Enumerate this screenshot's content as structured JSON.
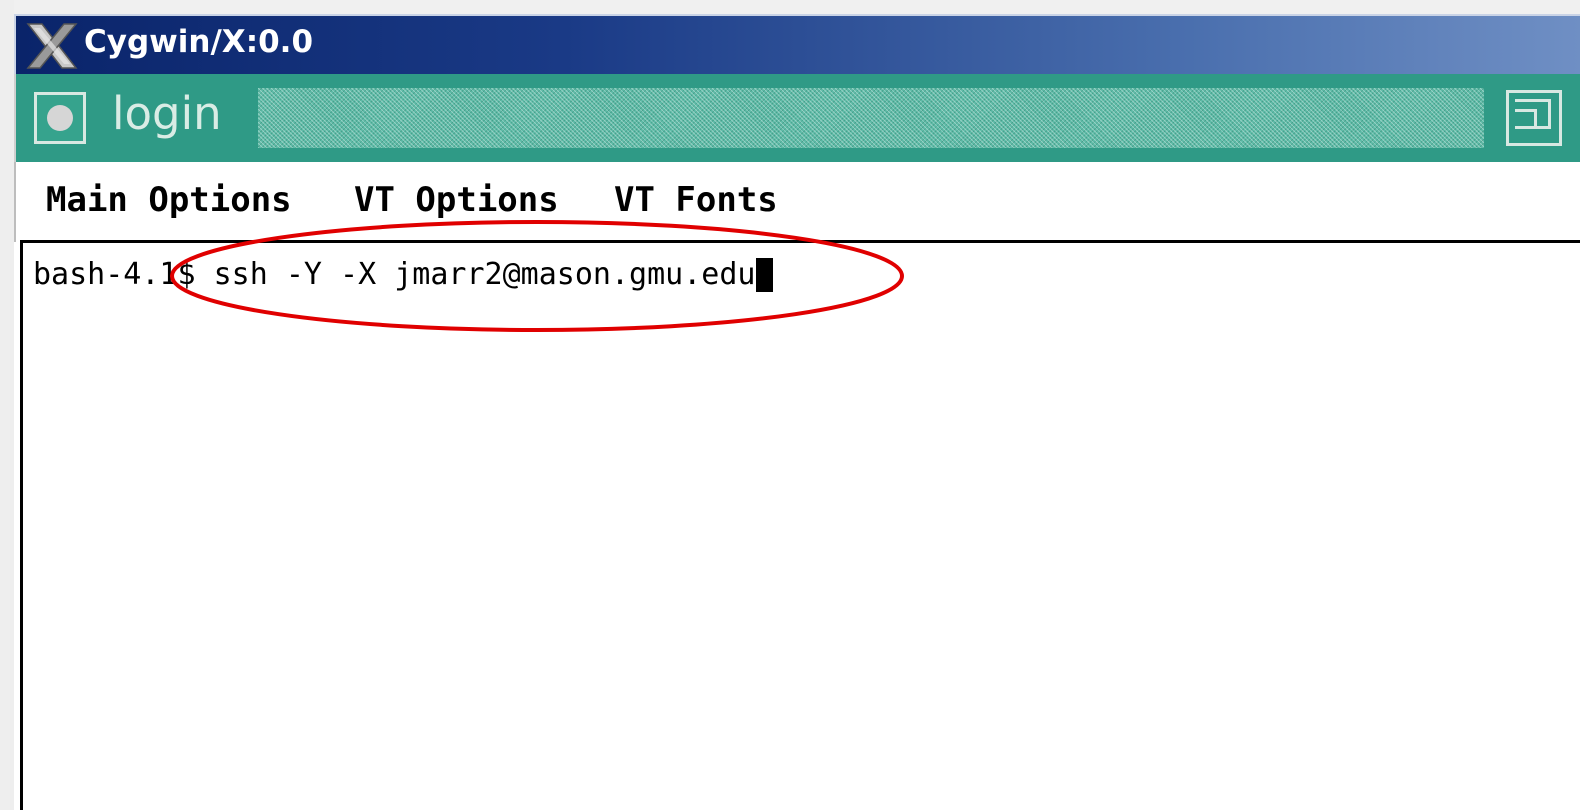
{
  "window": {
    "title": "Cygwin/X:0.0",
    "title_color": "#ffffff",
    "titlebar_color": "#0a246a"
  },
  "wm_bar": {
    "title": "login",
    "accent_color": "#2f9a86",
    "icons": [
      "iconify-icon",
      "resize-icon"
    ]
  },
  "menu": {
    "items": [
      "Main Options",
      "VT Options",
      "VT Fonts"
    ]
  },
  "terminal": {
    "prompt": "bash-4.1$",
    "command": " ssh -Y -X jmarr2@mason.gmu.edu",
    "background": "#ffffff",
    "foreground": "#000000"
  },
  "annotation": {
    "shape": "ellipse",
    "color": "#e00000"
  }
}
